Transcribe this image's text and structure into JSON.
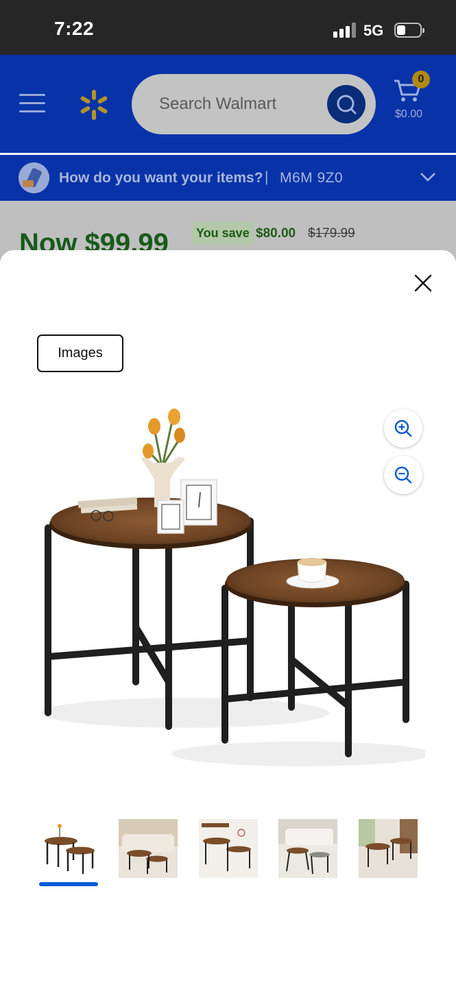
{
  "status_bar": {
    "time": "7:22",
    "network": "5G"
  },
  "header": {
    "search_placeholder": "Search Walmart",
    "cart_count": "0",
    "cart_total": "$0.00",
    "brand_color": "#0833a8",
    "spark_color": "#ffc220"
  },
  "delivery": {
    "question": "How do you want your items?",
    "separator": "|",
    "postal_code": "M6M 9Z0"
  },
  "price": {
    "now": "Now $99.99",
    "you_save_label": "You save",
    "save_amount": "$80.00",
    "was_price": "$179.99"
  },
  "gallery": {
    "tab_label": "Images",
    "main_image": "nesting-coffee-tables-rustic-brown",
    "thumbnails": [
      {
        "name": "tables-white-background",
        "selected": true
      },
      {
        "name": "tables-living-room"
      },
      {
        "name": "tables-dimensions"
      },
      {
        "name": "tables-lounge-setting"
      },
      {
        "name": "tables-with-plants"
      }
    ],
    "selected_index": 0,
    "selection_color": "#0b5bd6"
  }
}
